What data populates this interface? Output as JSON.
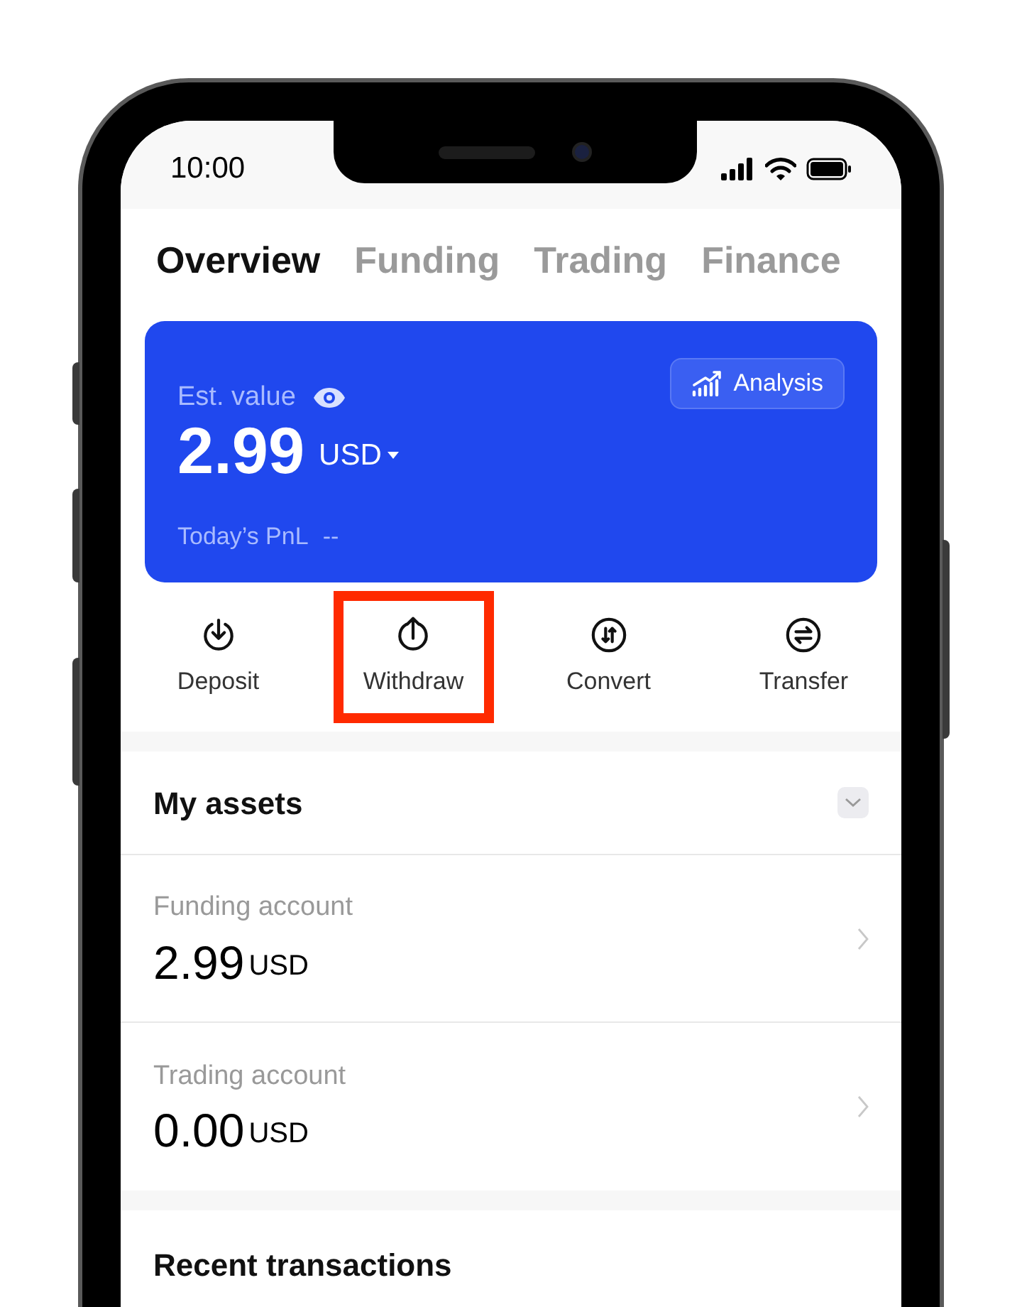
{
  "status_bar": {
    "time": "10:00"
  },
  "tabs": [
    {
      "label": "Overview",
      "selected": true
    },
    {
      "label": "Funding",
      "selected": false
    },
    {
      "label": "Trading",
      "selected": false
    },
    {
      "label": "Finance",
      "selected": false
    }
  ],
  "summary": {
    "label": "Est. value",
    "value": "2.99",
    "currency": "USD",
    "pnl_label": "Today’s PnL",
    "pnl_value": "--",
    "analysis_button": "Analysis"
  },
  "actions": [
    {
      "label": "Deposit",
      "kind": "down",
      "highlighted": false
    },
    {
      "label": "Withdraw",
      "kind": "up",
      "highlighted": true
    },
    {
      "label": "Convert",
      "kind": "swap",
      "highlighted": false
    },
    {
      "label": "Transfer",
      "kind": "transfer",
      "highlighted": false
    }
  ],
  "assets": {
    "title": "My assets",
    "accounts": [
      {
        "name": "Funding account",
        "amount": "2.99",
        "currency": "USD"
      },
      {
        "name": "Trading account",
        "amount": "0.00",
        "currency": "USD"
      }
    ]
  },
  "recent": {
    "title": "Recent transactions"
  }
}
